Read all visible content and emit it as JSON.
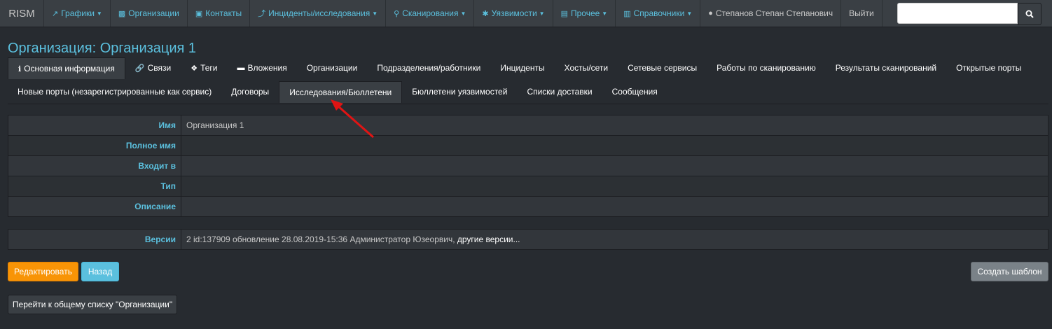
{
  "navbar": {
    "brand": "RISM",
    "items": [
      {
        "label": "Графики",
        "icon": "chart-icon",
        "glyph": "📈",
        "caret": true
      },
      {
        "label": "Организации",
        "icon": "building-icon",
        "glyph": "▮",
        "caret": false
      },
      {
        "label": "Контакты",
        "icon": "contact-card-icon",
        "glyph": "▣",
        "caret": false
      },
      {
        "label": "Инциденты/исследования",
        "icon": "bolt-icon",
        "glyph": "⚡",
        "caret": true
      },
      {
        "label": "Сканирования",
        "icon": "search-icon",
        "glyph": "🔍",
        "caret": true
      },
      {
        "label": "Уязвимости",
        "icon": "bug-icon",
        "glyph": "✱",
        "caret": true
      },
      {
        "label": "Прочее",
        "icon": "box-icon",
        "glyph": "▤",
        "caret": true
      },
      {
        "label": "Справочники",
        "icon": "book-icon",
        "glyph": "▥",
        "caret": true
      }
    ],
    "user_name": "Степанов Степан Степанович",
    "logout": "Выйти",
    "search_placeholder": ""
  },
  "page": {
    "title": "Организация: Организация 1"
  },
  "tabs_row1": [
    {
      "label": "Основная информация",
      "icon": "info-icon",
      "glyph": "ℹ"
    },
    {
      "label": "Связи",
      "icon": "link-icon",
      "glyph": "⚯"
    },
    {
      "label": "Теги",
      "icon": "tag-icon",
      "glyph": "⬘"
    },
    {
      "label": "Вложения",
      "icon": "folder-icon",
      "glyph": "▬"
    },
    {
      "label": "Организации"
    },
    {
      "label": "Подразделения/работники"
    },
    {
      "label": "Инциденты"
    },
    {
      "label": "Хосты/сети"
    },
    {
      "label": "Сетевые сервисы"
    },
    {
      "label": "Работы по сканированию"
    },
    {
      "label": "Результаты сканирований"
    },
    {
      "label": "Открытые порты"
    }
  ],
  "tabs_row2": [
    {
      "label": "Новые порты (незарегистрированные как сервис)"
    },
    {
      "label": "Договоры"
    },
    {
      "label": "Исследования/Бюллетени"
    },
    {
      "label": "Бюллетени уязвимостей"
    },
    {
      "label": "Списки доставки"
    },
    {
      "label": "Сообщения"
    }
  ],
  "fields": [
    {
      "label": "Имя",
      "value": "Организация 1"
    },
    {
      "label": "Полное имя",
      "value": ""
    },
    {
      "label": "Входит в",
      "value": ""
    },
    {
      "label": "Тип",
      "value": ""
    },
    {
      "label": "Описание",
      "value": ""
    }
  ],
  "versions": {
    "label": "Версии",
    "text": "2 id:137909 обновление 28.08.2019-15:36 Администратор Юзеорвич, ",
    "link": "другие версии..."
  },
  "buttons": {
    "edit": "Редактировать",
    "back": "Назад",
    "create_template": "Создать шаблон",
    "go_to_list": "Перейти к общему списку \"Организации\""
  },
  "colors": {
    "accent": "#5bc0de",
    "warning": "#f89406",
    "background": "#272b30",
    "annotation_arrow": "#e01414"
  }
}
